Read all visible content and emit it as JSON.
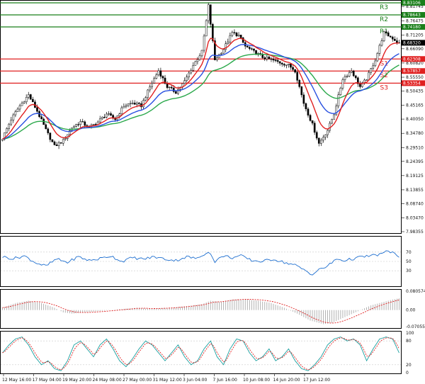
{
  "chart_data": [
    {
      "type": "candlestick",
      "ylim": [
        7.98355,
        8.83106
      ],
      "y_ticks": [
        "8.81745",
        "8.76475",
        "8.71205",
        "8.66090",
        "8.60820",
        "8.55550",
        "8.50435",
        "8.45165",
        "8.40050",
        "8.34780",
        "8.29510",
        "8.24395",
        "8.19125",
        "8.13855",
        "8.08740",
        "8.03470",
        "7.98355"
      ],
      "x_ticks": [
        "12 May 16:00",
        "17 May 04:00",
        "19 May 20:00",
        "24 May 08:00",
        "27 May 00:00",
        "31 May 12:00",
        "3 Jun 04:00",
        "7 Jun 16:00",
        "10 Jun 08:00",
        "14 Jun 20:00",
        "17 Jun 12:00"
      ],
      "current_price": "8.68320",
      "levels": [
        {
          "name": "R3",
          "value": 8.83106,
          "tag": "8.83106",
          "color": "#1a7f1a"
        },
        {
          "name": "R2",
          "value": 8.78643,
          "tag": "8.78643",
          "color": "#1a7f1a"
        },
        {
          "name": "R1",
          "value": 8.7418,
          "tag": "8.74180",
          "color": "#1a7f1a"
        },
        {
          "name": "S1",
          "value": 8.62308,
          "tag": "8.62308",
          "color": "#e02020"
        },
        {
          "name": "S2",
          "value": 8.57857,
          "tag": "8.57857",
          "color": "#e02020"
        },
        {
          "name": "S3",
          "value": 8.53354,
          "tag": "8.53354",
          "color": "#e02020"
        }
      ],
      "ma_colors": {
        "fast": "#e02020",
        "mid": "#2850e0",
        "slow": "#2aa84a"
      },
      "key_points": [
        [
          0,
          8.33
        ],
        [
          4,
          8.4
        ],
        [
          8,
          8.45
        ],
        [
          12,
          8.49
        ],
        [
          16,
          8.43
        ],
        [
          20,
          8.36
        ],
        [
          24,
          8.3
        ],
        [
          28,
          8.32
        ],
        [
          32,
          8.37
        ],
        [
          36,
          8.39
        ],
        [
          40,
          8.37
        ],
        [
          44,
          8.39
        ],
        [
          48,
          8.42
        ],
        [
          52,
          8.4
        ],
        [
          56,
          8.45
        ],
        [
          60,
          8.46
        ],
        [
          64,
          8.45
        ],
        [
          68,
          8.52
        ],
        [
          72,
          8.58
        ],
        [
          76,
          8.52
        ],
        [
          80,
          8.5
        ],
        [
          84,
          8.54
        ],
        [
          88,
          8.6
        ],
        [
          92,
          8.65
        ],
        [
          95,
          8.82
        ],
        [
          98,
          8.62
        ],
        [
          102,
          8.66
        ],
        [
          106,
          8.72
        ],
        [
          109,
          8.71
        ],
        [
          112,
          8.67
        ],
        [
          116,
          8.65
        ],
        [
          120,
          8.63
        ],
        [
          124,
          8.62
        ],
        [
          128,
          8.61
        ],
        [
          132,
          8.6
        ],
        [
          135,
          8.58
        ],
        [
          139,
          8.46
        ],
        [
          143,
          8.38
        ],
        [
          146,
          8.31
        ],
        [
          150,
          8.36
        ],
        [
          153,
          8.42
        ],
        [
          157,
          8.55
        ],
        [
          161,
          8.58
        ],
        [
          165,
          8.52
        ],
        [
          168,
          8.55
        ],
        [
          172,
          8.62
        ],
        [
          176,
          8.72
        ],
        [
          180,
          8.7
        ],
        [
          183,
          8.68
        ]
      ]
    },
    {
      "type": "line",
      "indicator": "oscillator",
      "ylim": [
        0,
        100
      ],
      "y_ticks": [
        "70",
        "50",
        "30"
      ],
      "key_points": [
        [
          0,
          60
        ],
        [
          5,
          56
        ],
        [
          10,
          62
        ],
        [
          15,
          48
        ],
        [
          20,
          40
        ],
        [
          25,
          55
        ],
        [
          30,
          48
        ],
        [
          35,
          60
        ],
        [
          40,
          52
        ],
        [
          45,
          56
        ],
        [
          50,
          62
        ],
        [
          55,
          50
        ],
        [
          60,
          58
        ],
        [
          65,
          55
        ],
        [
          70,
          60
        ],
        [
          75,
          55
        ],
        [
          80,
          52
        ],
        [
          85,
          60
        ],
        [
          90,
          56
        ],
        [
          95,
          72
        ],
        [
          98,
          50
        ],
        [
          102,
          62
        ],
        [
          106,
          58
        ],
        [
          110,
          62
        ],
        [
          115,
          52
        ],
        [
          120,
          50
        ],
        [
          125,
          55
        ],
        [
          130,
          48
        ],
        [
          135,
          42
        ],
        [
          140,
          30
        ],
        [
          143,
          22
        ],
        [
          146,
          32
        ],
        [
          150,
          40
        ],
        [
          154,
          55
        ],
        [
          158,
          52
        ],
        [
          162,
          56
        ],
        [
          166,
          60
        ],
        [
          170,
          62
        ],
        [
          174,
          65
        ],
        [
          178,
          72
        ],
        [
          181,
          68
        ],
        [
          183,
          58
        ]
      ]
    },
    {
      "type": "bar",
      "indicator": "histogram",
      "ylim": [
        -0.07055,
        0.080574
      ],
      "y_ticks": [
        "0.080574",
        "0.00",
        "-0.07055"
      ],
      "key_points": [
        [
          0,
          0.01
        ],
        [
          6,
          0.03
        ],
        [
          12,
          0.04
        ],
        [
          18,
          0.03
        ],
        [
          24,
          0.01
        ],
        [
          28,
          -0.01
        ],
        [
          32,
          -0.015
        ],
        [
          38,
          -0.01
        ],
        [
          44,
          -0.005
        ],
        [
          50,
          0.0
        ],
        [
          56,
          0.005
        ],
        [
          62,
          0.01
        ],
        [
          68,
          0.005
        ],
        [
          74,
          0.008
        ],
        [
          80,
          0.012
        ],
        [
          86,
          0.018
        ],
        [
          92,
          0.025
        ],
        [
          96,
          0.04
        ],
        [
          100,
          0.035
        ],
        [
          106,
          0.045
        ],
        [
          112,
          0.045
        ],
        [
          118,
          0.04
        ],
        [
          124,
          0.03
        ],
        [
          130,
          0.01
        ],
        [
          136,
          -0.015
        ],
        [
          142,
          -0.045
        ],
        [
          148,
          -0.06
        ],
        [
          152,
          -0.055
        ],
        [
          158,
          -0.03
        ],
        [
          164,
          -0.005
        ],
        [
          170,
          0.02
        ],
        [
          176,
          0.035
        ],
        [
          180,
          0.045
        ],
        [
          183,
          0.05
        ]
      ]
    },
    {
      "type": "line",
      "indicator": "oscillator",
      "ylim": [
        0,
        100
      ],
      "y_ticks": [
        "100",
        "80",
        "20",
        "0"
      ],
      "key_points": [
        [
          0,
          50
        ],
        [
          3,
          70
        ],
        [
          6,
          85
        ],
        [
          9,
          90
        ],
        [
          12,
          70
        ],
        [
          15,
          40
        ],
        [
          18,
          20
        ],
        [
          21,
          30
        ],
        [
          24,
          10
        ],
        [
          27,
          5
        ],
        [
          30,
          30
        ],
        [
          33,
          70
        ],
        [
          36,
          80
        ],
        [
          39,
          60
        ],
        [
          42,
          40
        ],
        [
          45,
          70
        ],
        [
          48,
          85
        ],
        [
          51,
          60
        ],
        [
          54,
          30
        ],
        [
          57,
          15
        ],
        [
          60,
          35
        ],
        [
          63,
          60
        ],
        [
          66,
          80
        ],
        [
          69,
          70
        ],
        [
          72,
          50
        ],
        [
          75,
          30
        ],
        [
          78,
          50
        ],
        [
          81,
          70
        ],
        [
          84,
          40
        ],
        [
          87,
          20
        ],
        [
          90,
          30
        ],
        [
          93,
          60
        ],
        [
          96,
          80
        ],
        [
          99,
          40
        ],
        [
          102,
          20
        ],
        [
          105,
          60
        ],
        [
          108,
          85
        ],
        [
          111,
          80
        ],
        [
          114,
          50
        ],
        [
          117,
          30
        ],
        [
          120,
          40
        ],
        [
          123,
          60
        ],
        [
          126,
          30
        ],
        [
          129,
          40
        ],
        [
          132,
          60
        ],
        [
          135,
          30
        ],
        [
          138,
          10
        ],
        [
          141,
          5
        ],
        [
          144,
          20
        ],
        [
          147,
          40
        ],
        [
          150,
          70
        ],
        [
          153,
          85
        ],
        [
          156,
          90
        ],
        [
          159,
          80
        ],
        [
          162,
          85
        ],
        [
          165,
          70
        ],
        [
          168,
          30
        ],
        [
          171,
          60
        ],
        [
          174,
          85
        ],
        [
          177,
          90
        ],
        [
          180,
          85
        ],
        [
          183,
          50
        ]
      ]
    }
  ]
}
